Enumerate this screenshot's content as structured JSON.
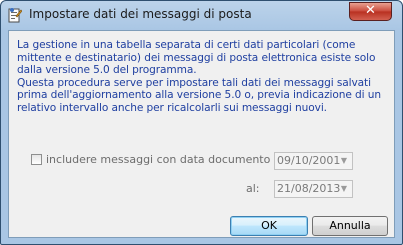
{
  "window": {
    "title": "Impostare dati dei messaggi di posta",
    "close_label": "✕"
  },
  "info": {
    "paragraph1": "La gestione in una tabella separata di certi dati particolari (come mittente e destinatario) dei messaggi di posta elettronica esiste solo dalla versione 5.0 del programma.",
    "paragraph2": "Questa procedura serve per impostare tali dati dei messaggi salvati prima dell'aggiornamento alla versione 5.0 o, previa indicazione di un relativo intervallo anche per ricalcolarli sui messaggi nuovi."
  },
  "filter": {
    "checkbox_label": "includere messaggi con data documento dal:",
    "checked": false,
    "date_from": "09/10/2001",
    "to_label": "al:",
    "date_to": "21/08/2013"
  },
  "buttons": {
    "ok": "OK",
    "cancel": "Annulla"
  }
}
